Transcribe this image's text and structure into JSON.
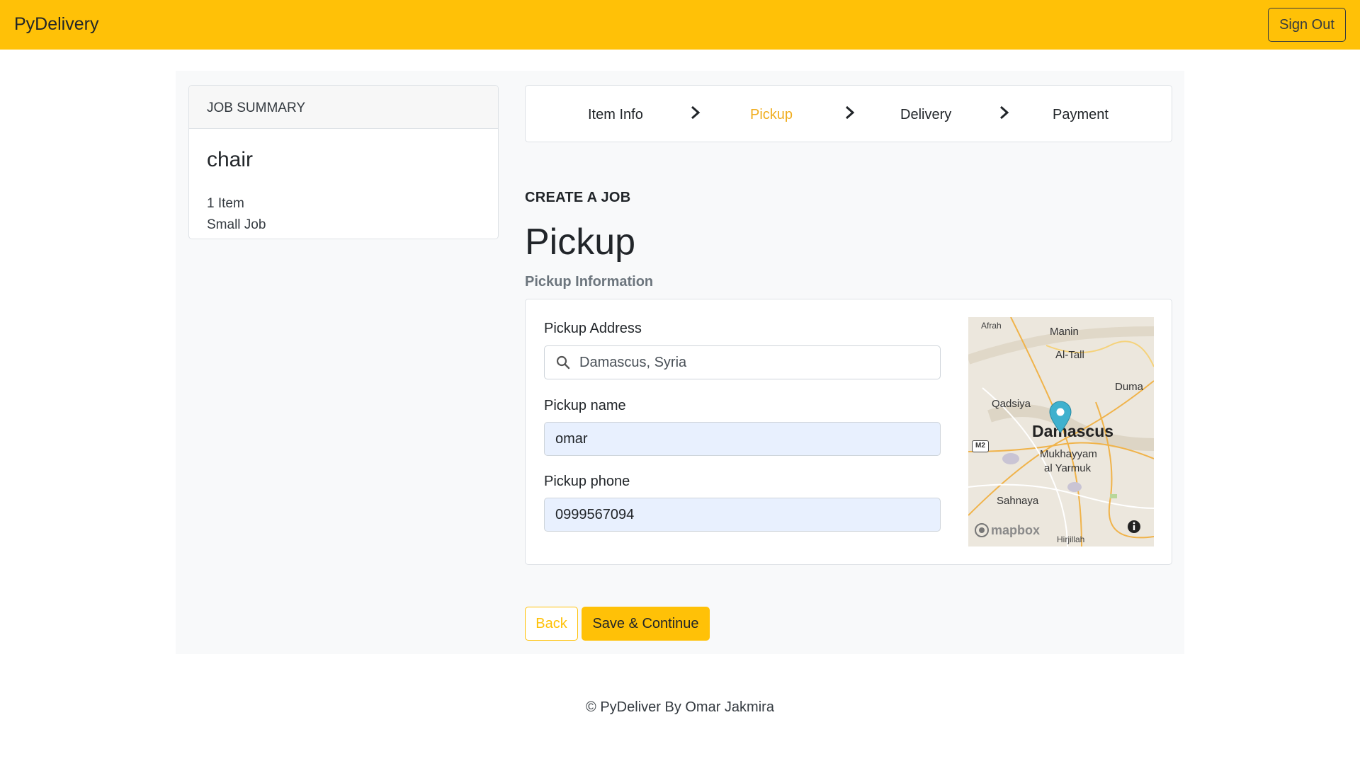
{
  "navbar": {
    "brand": "PyDelivery",
    "signout_label": "Sign Out",
    "color": "#ffc107"
  },
  "summary": {
    "header": "JOB SUMMARY",
    "title": "chair",
    "items": "1 Item",
    "size": "Small Job"
  },
  "steps": [
    {
      "label": "Item Info",
      "active": false
    },
    {
      "label": "Pickup",
      "active": true
    },
    {
      "label": "Delivery",
      "active": false
    },
    {
      "label": "Payment",
      "active": false
    }
  ],
  "page": {
    "eyebrow": "CREATE A JOB",
    "title": "Pickup",
    "subtitle": "Pickup Information"
  },
  "form": {
    "address_label": "Pickup Address",
    "address_value": "Damascus, Syria",
    "name_label": "Pickup name",
    "name_value": "omar",
    "phone_label": "Pickup phone",
    "phone_value": "0999567094"
  },
  "map": {
    "city": "Damascus",
    "places": [
      "Afrah",
      "Manin",
      "Al-Tall",
      "Duma",
      "Qadsiya",
      "Mukhayyam",
      "al Yarmuk",
      "Sahnaya",
      "Hirjillah"
    ],
    "road_badge": "M2",
    "attribution": "mapbox",
    "marker_icon": "map-pin-icon"
  },
  "buttons": {
    "back": "Back",
    "save": "Save & Continue"
  },
  "footer": {
    "text": "© PyDeliver By Omar Jakmira"
  }
}
